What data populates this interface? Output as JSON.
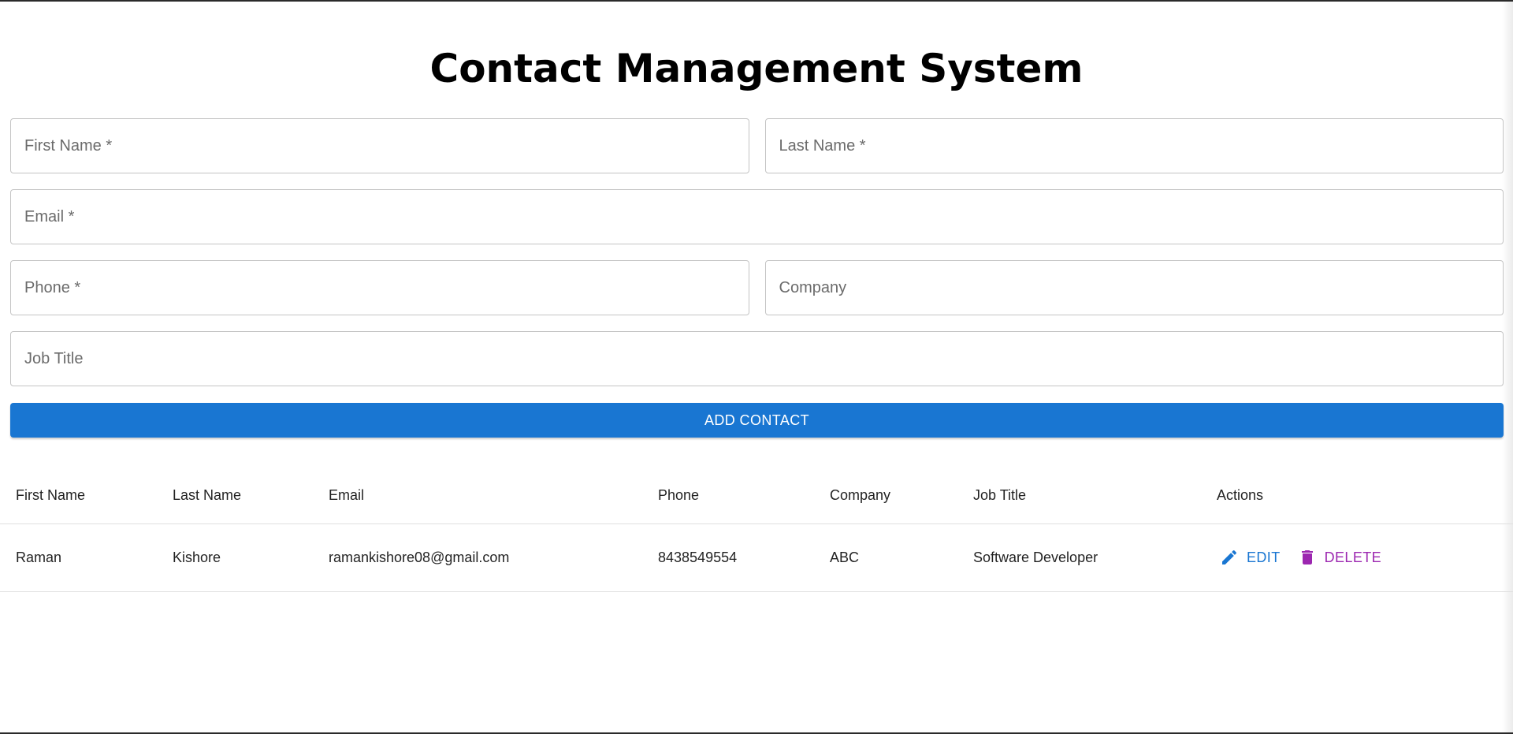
{
  "page": {
    "title": "Contact Management System"
  },
  "form": {
    "first_name": {
      "placeholder": "First Name *",
      "value": ""
    },
    "last_name": {
      "placeholder": "Last Name *",
      "value": ""
    },
    "email": {
      "placeholder": "Email *",
      "value": ""
    },
    "phone": {
      "placeholder": "Phone *",
      "value": ""
    },
    "company": {
      "placeholder": "Company",
      "value": ""
    },
    "job_title": {
      "placeholder": "Job Title",
      "value": ""
    },
    "submit_label": "ADD CONTACT"
  },
  "table": {
    "headers": [
      "First Name",
      "Last Name",
      "Email",
      "Phone",
      "Company",
      "Job Title",
      "Actions"
    ],
    "rows": [
      {
        "first_name": "Raman",
        "last_name": "Kishore",
        "email": "ramankishore08@gmail.com",
        "phone": "8438549554",
        "company": "ABC",
        "job_title": "Software Developer",
        "edit_label": "EDIT",
        "delete_label": "DELETE"
      }
    ]
  },
  "icons": {
    "edit": "pencil-icon",
    "delete": "trash-icon"
  },
  "colors": {
    "primary": "#1976d2",
    "secondary": "#9c27b0",
    "border": "#c4c4c4"
  }
}
